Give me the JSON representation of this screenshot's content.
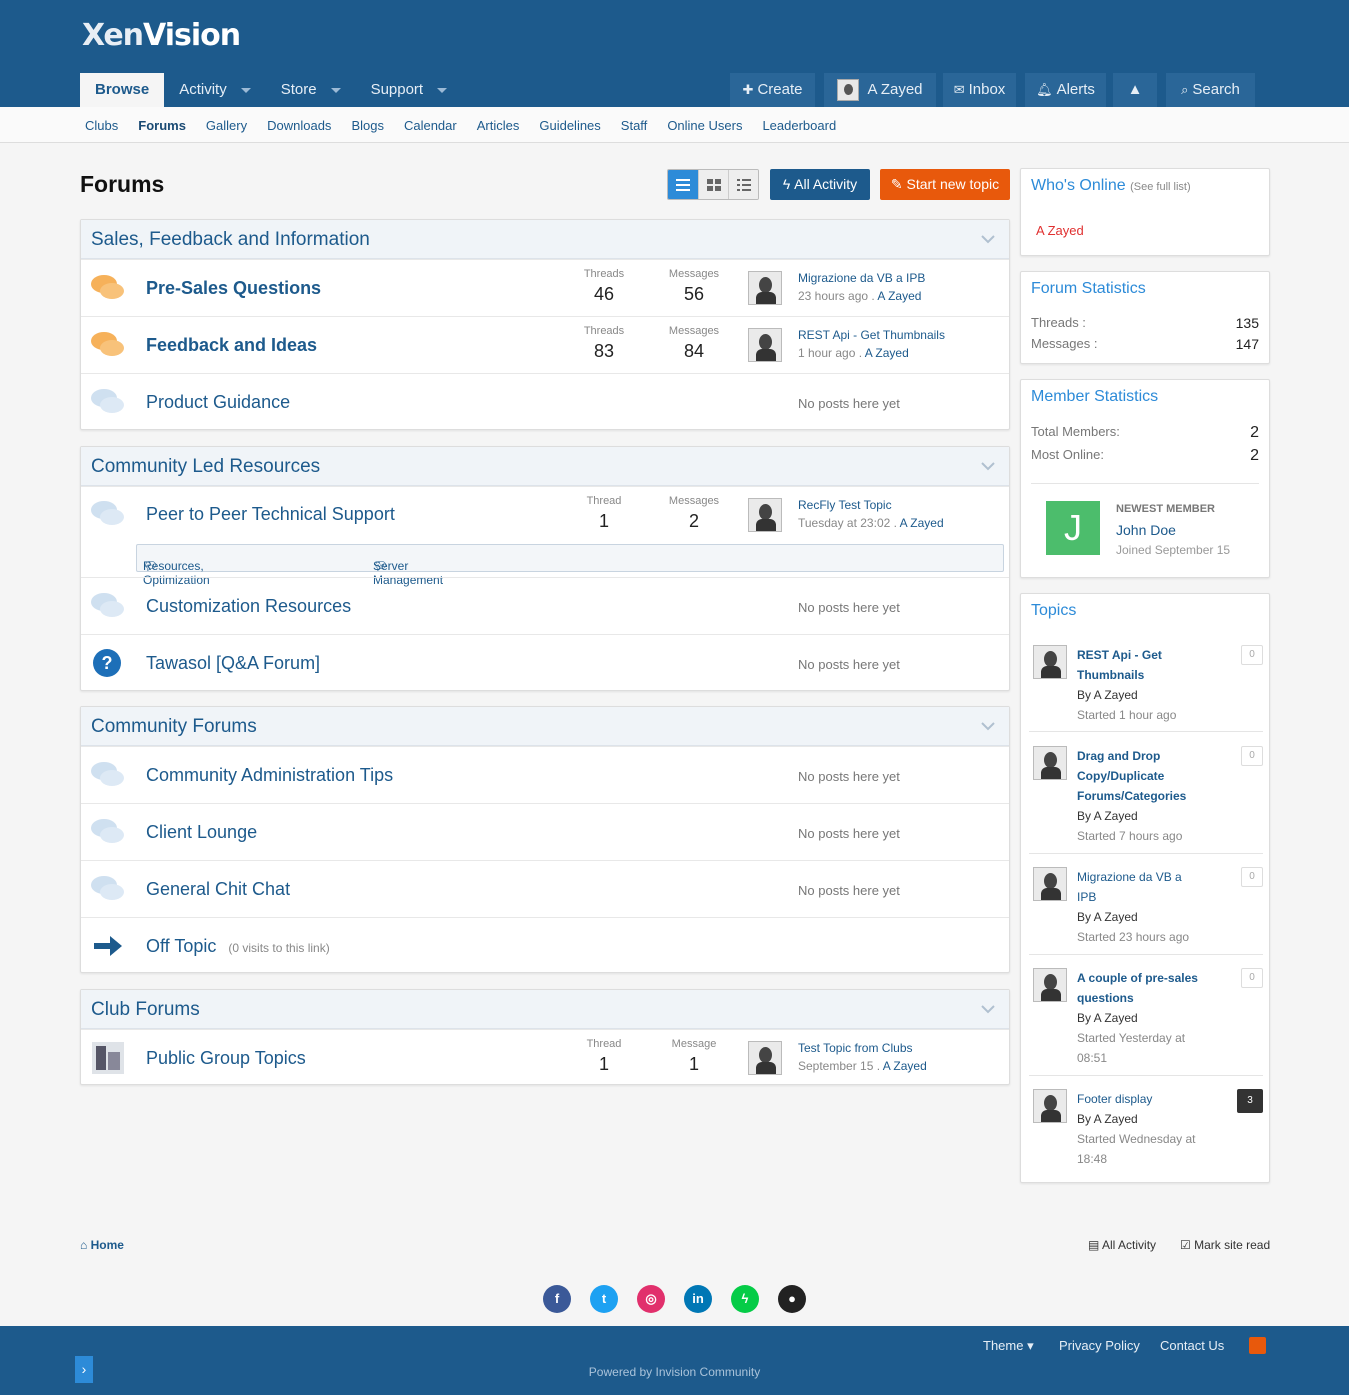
{
  "brand": {
    "name_part1": "Xen",
    "name_part2": "Vision"
  },
  "main_nav": [
    {
      "label": "Browse",
      "active": true
    },
    {
      "label": "Activity"
    },
    {
      "label": "Store"
    },
    {
      "label": "Support"
    }
  ],
  "user_nav": {
    "create": "Create",
    "user": "A Zayed",
    "inbox": "Inbox",
    "alerts": "Alerts",
    "search": "Search"
  },
  "sub_nav": [
    "Clubs",
    "Forums",
    "Gallery",
    "Downloads",
    "Blogs",
    "Calendar",
    "Articles",
    "Guidelines",
    "Staff",
    "Online Users",
    "Leaderboard"
  ],
  "page": {
    "title": "Forums",
    "all_activity": "All Activity",
    "start_new_topic": "Start new topic"
  },
  "categories": [
    {
      "title": "Sales, Feedback and Information",
      "forums": [
        {
          "name": "Pre-Sales Questions",
          "threads_label": "Threads",
          "threads": "46",
          "messages_label": "Messages",
          "messages": "56",
          "last_title": "Migrazione da VB a IPB",
          "last_time": "23 hours ago .",
          "last_user": "A Zayed"
        },
        {
          "name": "Feedback and Ideas",
          "threads_label": "Threads",
          "threads": "83",
          "messages_label": "Messages",
          "messages": "84",
          "last_title": "REST Api - Get Thumbnails",
          "last_time": "1 hour ago .",
          "last_user": "A Zayed"
        },
        {
          "name": "Product Guidance",
          "no_posts": "No posts here yet"
        }
      ]
    },
    {
      "title": "Community Led Resources",
      "forums": [
        {
          "name": "Peer to Peer Technical Support",
          "threads_label": "Thread",
          "threads": "1",
          "messages_label": "Messages",
          "messages": "2",
          "last_title": "RecFly Test Topic",
          "last_time": "Tuesday at 23:02 .",
          "last_user": "A Zayed",
          "subforums": [
            "Resources, Optimization",
            "Server Management"
          ]
        },
        {
          "name": "Customization Resources",
          "no_posts": "No posts here yet"
        },
        {
          "name": "Tawasol [Q&A Forum]",
          "no_posts": "No posts here yet"
        }
      ]
    },
    {
      "title": "Community Forums",
      "forums": [
        {
          "name": "Community Administration Tips",
          "no_posts": "No posts here yet"
        },
        {
          "name": "Client Lounge",
          "no_posts": "No posts here yet"
        },
        {
          "name": "General Chit Chat",
          "no_posts": "No posts here yet"
        },
        {
          "name": "Off Topic",
          "visits": "(0 visits to this link)"
        }
      ]
    },
    {
      "title": "Club Forums",
      "forums": [
        {
          "name": "Public Group Topics",
          "threads_label": "Thread",
          "threads": "1",
          "messages_label": "Message",
          "messages": "1",
          "last_title": "Test Topic from Clubs",
          "last_time": "September 15 .",
          "last_user": "A Zayed"
        }
      ]
    }
  ],
  "sidebar": {
    "whos_online": {
      "title": "Who's Online",
      "see_full": "(See full list)",
      "user": "A Zayed"
    },
    "forum_stats": {
      "title": "Forum Statistics",
      "threads_label": "Threads :",
      "threads": "135",
      "messages_label": "Messages :",
      "messages": "147"
    },
    "member_stats": {
      "title": "Member Statistics",
      "total_label": "Total Members:",
      "total": "2",
      "most_label": "Most Online:",
      "most": "2",
      "newest_label": "NEWEST MEMBER",
      "newest_initial": "J",
      "newest_name": "John Doe",
      "newest_joined": "Joined September 15"
    },
    "topics": {
      "title": "Topics",
      "items": [
        {
          "title_l1": "REST Api - Get",
          "title_l2": "Thumbnails",
          "by": "By A Zayed",
          "started_l1": "Started 1 hour ago",
          "count": "0"
        },
        {
          "title_l1": "Drag and Drop",
          "title_l2": "Copy/Duplicate",
          "title_l3": "Forums/Categories",
          "by": "By A Zayed",
          "started_l1": "Started 7 hours ago",
          "count": "0"
        },
        {
          "title_l1": "Migrazione da VB a",
          "title_l2": "IPB",
          "by": "By A Zayed",
          "started_l1": "Started 23 hours ago",
          "count": "0"
        },
        {
          "title_l1": "A couple of pre-sales",
          "title_l2": "questions",
          "by": "By A Zayed",
          "started_l1": "Started Yesterday at",
          "started_l2": "08:51",
          "count": "0"
        },
        {
          "title_l1": "Footer display",
          "by": "By A Zayed",
          "started_l1": "Started Wednesday at",
          "started_l2": "18:48",
          "count": "3"
        }
      ]
    }
  },
  "footer": {
    "home": "Home",
    "all_activity": "All Activity",
    "mark_read": "Mark site read",
    "social": [
      {
        "icon": "facebook-icon",
        "glyph": "f",
        "color": "#3b5998"
      },
      {
        "icon": "twitter-icon",
        "glyph": "t",
        "color": "#1da1f2"
      },
      {
        "icon": "instagram-icon",
        "glyph": "◎",
        "color": "#e1306c"
      },
      {
        "icon": "linkedin-icon",
        "glyph": "in",
        "color": "#0077b5"
      },
      {
        "icon": "deviantart-icon",
        "glyph": "ϟ",
        "color": "#05cc47"
      },
      {
        "icon": "discord-icon",
        "glyph": "●",
        "color": "#222222"
      }
    ],
    "theme": "Theme",
    "privacy": "Privacy Policy",
    "contact": "Contact Us",
    "powered": "Powered by Invision Community"
  },
  "colors": {
    "primary": "#1d5a8c",
    "accent": "#2d8bd8",
    "orange": "#e8590c",
    "green_avatar": "#4cbd6c"
  }
}
